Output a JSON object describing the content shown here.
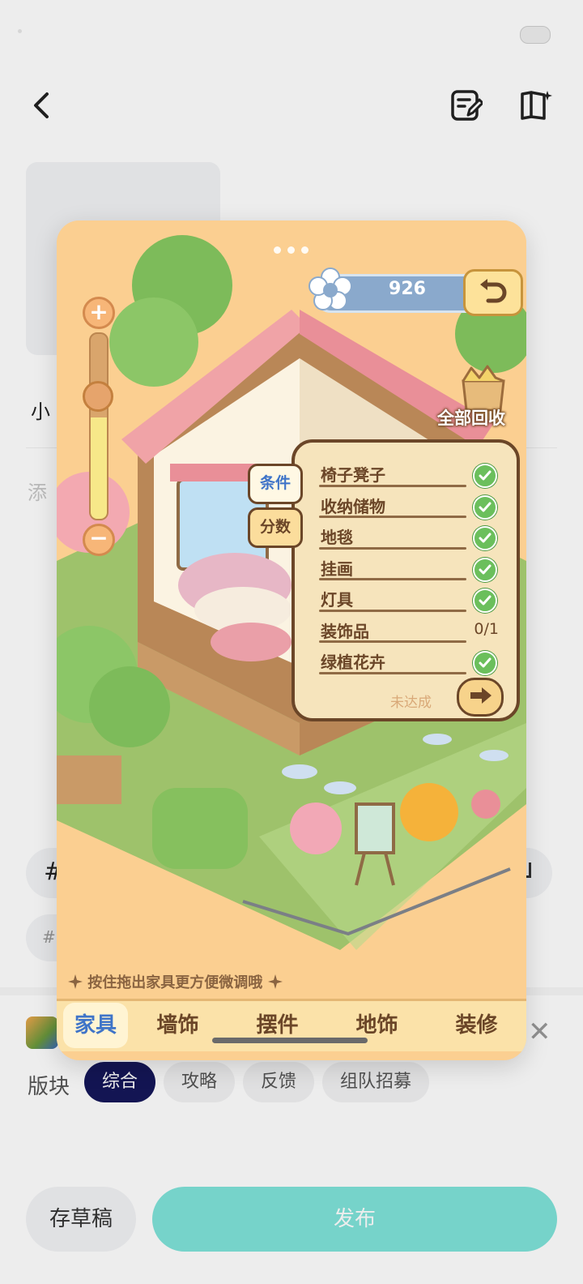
{
  "header": {
    "back_icon": "chevron-left-icon",
    "edit_icon": "edit-note-icon",
    "book_icon": "book-sparkle-icon"
  },
  "post": {
    "title_partial": "小",
    "body_placeholder_partial": "添"
  },
  "topic": {
    "hash": "#",
    "hash_chip": "#"
  },
  "board": {
    "label": "版块",
    "chips": [
      {
        "label": "综合",
        "active": true
      },
      {
        "label": "攻略",
        "active": false
      },
      {
        "label": "反馈",
        "active": false
      },
      {
        "label": "组队招募",
        "active": false
      }
    ]
  },
  "actions": {
    "draft": "存草稿",
    "publish": "发布",
    "publish_color": "#7fe4da"
  },
  "game": {
    "score": "926",
    "recycle_label": "全部回收",
    "tabs_side": {
      "condition": "条件",
      "score": "分数"
    },
    "requirements": [
      {
        "name": "椅子凳子",
        "done": true,
        "progress": ""
      },
      {
        "name": "收纳储物",
        "done": true,
        "progress": ""
      },
      {
        "name": "地毯",
        "done": true,
        "progress": ""
      },
      {
        "name": "挂画",
        "done": true,
        "progress": ""
      },
      {
        "name": "灯具",
        "done": true,
        "progress": ""
      },
      {
        "name": "装饰品",
        "done": false,
        "progress": "0/1"
      },
      {
        "name": "绿植花卉",
        "done": true,
        "progress": ""
      }
    ],
    "status": "未达成",
    "hint": "按住拖出家具更方便微调哦",
    "bottom_tabs": [
      {
        "label": "家具",
        "active": true
      },
      {
        "label": "墙饰",
        "active": false
      },
      {
        "label": "摆件",
        "active": false
      },
      {
        "label": "地饰",
        "active": false
      },
      {
        "label": "装修",
        "active": false
      }
    ],
    "zoom_level": 0.55
  }
}
